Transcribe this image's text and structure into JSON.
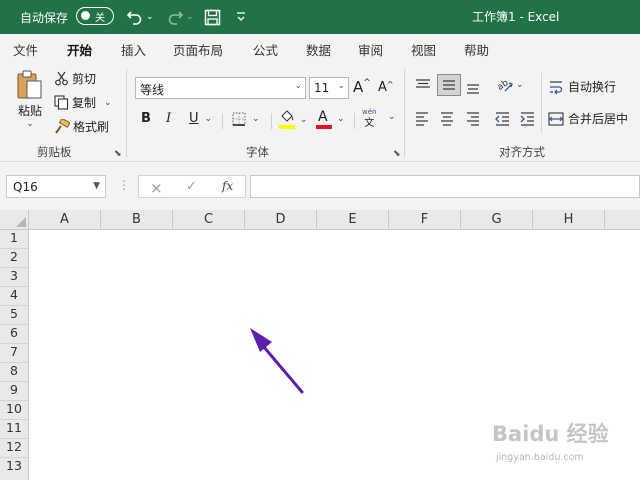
{
  "titlebar": {
    "autosave_label": "自动保存",
    "autosave_state": "关",
    "title": "工作簿1  -  Excel"
  },
  "tabs": [
    "文件",
    "开始",
    "插入",
    "页面布局",
    "公式",
    "数据",
    "审阅",
    "视图",
    "帮助"
  ],
  "active_tab": "开始",
  "ribbon": {
    "clipboard": {
      "paste_label": "粘贴",
      "cut_label": "剪切",
      "copy_label": "复制",
      "format_painter_label": "格式刷",
      "group_label": "剪贴板"
    },
    "font": {
      "font_name": "等线",
      "font_size": "11",
      "bold": "B",
      "italic": "I",
      "underline": "U",
      "grow": "A",
      "shrink": "A",
      "font_color_letter": "A",
      "phonetic_top": "wén",
      "phonetic_bottom": "文",
      "group_label": "字体"
    },
    "alignment": {
      "wrap_text_label": "自动换行",
      "merge_center_label": "合并后居中",
      "group_label": "对齐方式"
    }
  },
  "formula_bar": {
    "name_box": "Q16",
    "cancel_icon": "×",
    "enter_icon": "✓",
    "fx_label": "fx",
    "formula_value": ""
  },
  "sheet": {
    "columns": [
      "A",
      "B",
      "C",
      "D",
      "E",
      "F",
      "G",
      "H"
    ],
    "rows": [
      "1",
      "2",
      "3",
      "4",
      "5",
      "6",
      "7",
      "8",
      "9",
      "10",
      "11",
      "12",
      "13"
    ]
  },
  "annotation": {
    "arrow_color": "#5a1fa6"
  },
  "watermark": {
    "top": "Baidu 经验",
    "bottom": "jingyan.baidu.com"
  },
  "colors": {
    "excel_green": "#217346",
    "highlight_yellow": "#ffff00",
    "font_red": "#e81123"
  }
}
